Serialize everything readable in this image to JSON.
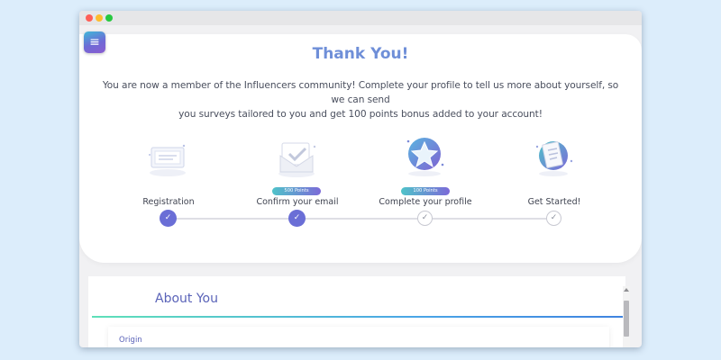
{
  "window": {
    "controls": [
      "close",
      "minimize",
      "maximize"
    ],
    "control_colors": [
      "#ff5f57",
      "#febc2e",
      "#28c840"
    ]
  },
  "menu": {
    "icon": "hamburger-icon",
    "glyph": "≡"
  },
  "header": {
    "title": "Thank You!",
    "intro_line1": "You are now a member of the Influencers community! Complete your profile to tell us more about yourself, so we can send",
    "intro_line2": "you surveys tailored to you and get 100 points bonus added to your account!"
  },
  "steps": [
    {
      "label": "Registration",
      "badge": "",
      "done": true,
      "icon": "certificate-icon"
    },
    {
      "label": "Confirm your email",
      "badge": "500 Points",
      "done": true,
      "icon": "envelope-icon"
    },
    {
      "label": "Complete your profile",
      "badge": "100 Points",
      "done": false,
      "icon": "star-icon"
    },
    {
      "label": "Get Started!",
      "badge": "",
      "done": false,
      "icon": "clipboard-icon"
    }
  ],
  "check_glyph": "✓",
  "about": {
    "title": "About You",
    "field_label": "Origin"
  },
  "colors": {
    "accent": "#6a6ed6",
    "title": "#6f8fd8",
    "background": "#dcedfb"
  }
}
